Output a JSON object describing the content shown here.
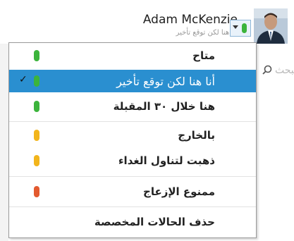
{
  "header": {
    "user_name": "Adam McKenzie",
    "user_note": "أنا هنا لكن توقع تأخير",
    "current_status_color": "#3cb43c"
  },
  "search": {
    "hint": "البحث"
  },
  "menu": {
    "items": [
      {
        "label": "متاح",
        "color": "#3cb43c"
      },
      {
        "label": "أنا هنا لكن توقع تأخير",
        "color": "#3cb43c",
        "selected": true
      },
      {
        "label": "هنا خلال ٣٠ المقبلة",
        "color": "#3cb43c"
      },
      {
        "label": "بالخارج",
        "color": "#f2b51c"
      },
      {
        "label": "ذهبت لتناول الغداء",
        "color": "#f2b51c"
      },
      {
        "label": "ممنوع الإزعاج",
        "color": "#e35a2f"
      },
      {
        "label": "حذف الحالات المخصصة"
      }
    ]
  }
}
